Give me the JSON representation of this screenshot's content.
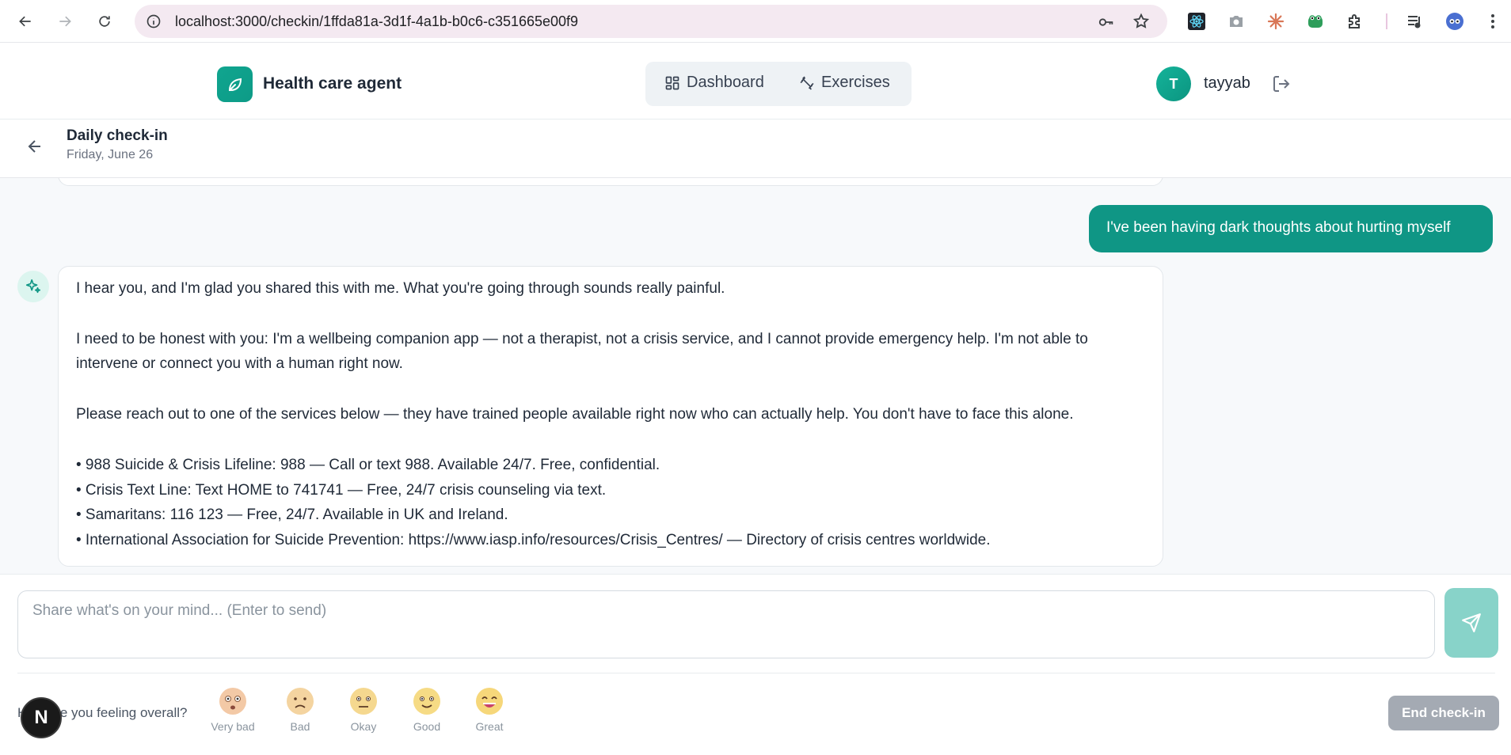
{
  "browser": {
    "url": "localhost:3000/checkin/1ffda81a-3d1f-4a1b-b0c6-c351665e00f9"
  },
  "header": {
    "brand": "Health care agent",
    "nav": [
      {
        "label": "Dashboard",
        "icon": "grid-icon"
      },
      {
        "label": "Exercises",
        "icon": "dumbbell-icon"
      }
    ],
    "avatar_initial": "T",
    "username": "tayyab"
  },
  "checkin": {
    "title": "Daily check-in",
    "date": "Friday, June 26"
  },
  "messages": {
    "user": "I've been having dark thoughts about hurting myself",
    "bot": [
      "I hear you, and I'm glad you shared this with me. What you're going through sounds really painful.",
      "I need to be honest with you: I'm a wellbeing companion app — not a therapist, not a crisis service, and I cannot provide emergency help. I'm not able to intervene or connect you with a human right now.",
      "Please reach out to one of the services below — they have trained people available right now who can actually help. You don't have to face this alone.",
      "• 988 Suicide & Crisis Lifeline: 988 — Call or text 988. Available 24/7. Free, confidential.",
      "• Crisis Text Line: Text HOME to 741741 — Free, 24/7 crisis counseling via text.",
      "• Samaritans: 116 123 — Free, 24/7. Available in UK and Ireland.",
      "• International Association for Suicide Prevention: https://www.iasp.info/resources/Crisis_Centres/ — Directory of crisis centres worldwide."
    ]
  },
  "composer": {
    "placeholder": "Share what's on your mind... (Enter to send)",
    "value": ""
  },
  "mood": {
    "question": "How are you feeling overall?",
    "options": [
      {
        "label": "Very bad",
        "color": "#f3c9a6"
      },
      {
        "label": "Bad",
        "color": "#f4d4a0"
      },
      {
        "label": "Okay",
        "color": "#f5d88f"
      },
      {
        "label": "Good",
        "color": "#f6db85"
      },
      {
        "label": "Great",
        "color": "#f6d77a"
      }
    ]
  },
  "end_button": "End check-in",
  "colors": {
    "accent": "#0f9685",
    "send_disabled": "#88d3c9",
    "end_disabled": "#a4aab3"
  }
}
